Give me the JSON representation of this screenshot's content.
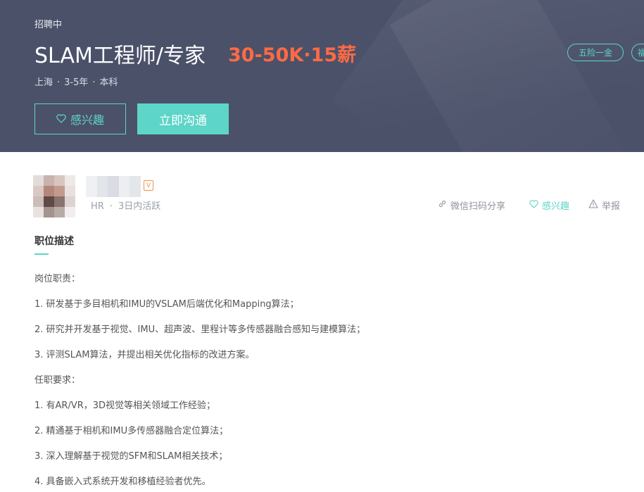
{
  "header": {
    "status": "招聘中",
    "title": "SLAM工程师/专家",
    "salary": "30-50K·15薪",
    "location": "上海",
    "experience": "3-5年",
    "education": "本科",
    "separator": "·",
    "interest_button": "感兴趣",
    "chat_button": "立即沟通",
    "tags": [
      "五险一金",
      "福"
    ]
  },
  "recruiter": {
    "role": "HR",
    "separator": "·",
    "activity": "3日内活跃",
    "badge": "V"
  },
  "actions": {
    "share": "微信扫码分享",
    "interest": "感兴趣",
    "report": "举报"
  },
  "description": {
    "heading": "职位描述",
    "lines": [
      "岗位职责：",
      "1. 研发基于多目相机和IMU的VSLAM后端优化和Mapping算法；",
      "2. 研究并开发基于视觉、IMU、超声波、里程计等多传感器融合感知与建模算法；",
      "3. 评测SLAM算法，并提出相关优化指标的改进方案。",
      "任职要求：",
      "1. 有AR/VR，3D视觉等相关领域工作经验；",
      "2. 精通基于相机和IMU多传感器融合定位算法；",
      "3. 深入理解基于视觉的SFM和SLAM相关技术；",
      "4. 具备嵌入式系统开发和移植经验者优先。"
    ]
  },
  "colors": {
    "banner": "#4b5169",
    "accent": "#5dd5c8",
    "salary": "#ff6a44"
  }
}
